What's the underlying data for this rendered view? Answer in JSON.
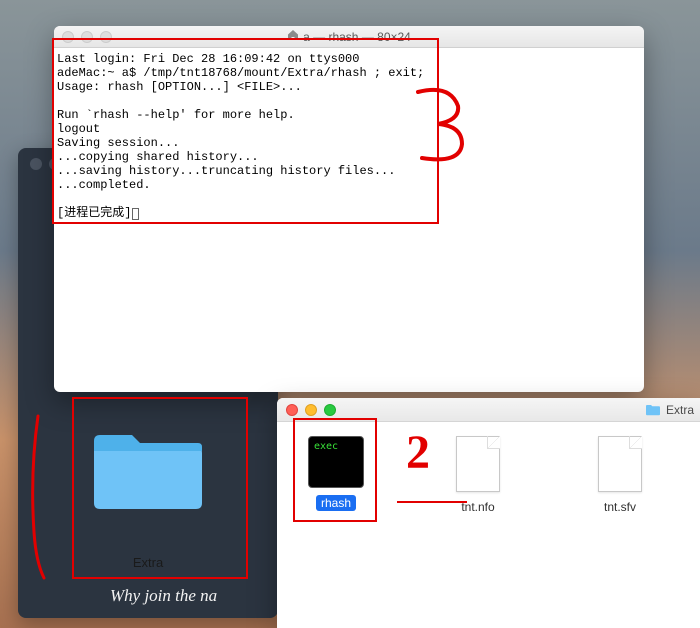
{
  "terminal": {
    "title": "a — rhash — 80×24",
    "lines": [
      "Last login: Fri Dec 28 16:09:42 on ttys000",
      "adeMac:~ a$ /tmp/tnt18768/mount/Extra/rhash ; exit;",
      "Usage: rhash [OPTION...] <FILE>...",
      "",
      "Run `rhash --help' for more help.",
      "logout",
      "Saving session...",
      "...copying shared history...",
      "...saving history...truncating history files...",
      "...completed.",
      "",
      "[进程已完成]"
    ]
  },
  "finder": {
    "title": "Extra",
    "files": [
      {
        "name": "rhash",
        "type": "exec",
        "selected": true
      },
      {
        "name": "tnt.nfo",
        "type": "doc",
        "selected": false
      },
      {
        "name": "tnt.sfv",
        "type": "doc",
        "selected": false
      }
    ],
    "exec_badge": "exec"
  },
  "darkwin": {
    "folder_label": "Extra",
    "tagline": "Why join the na"
  },
  "annotations": {
    "num1_implied": "1",
    "num2": "2",
    "num3": "3"
  }
}
